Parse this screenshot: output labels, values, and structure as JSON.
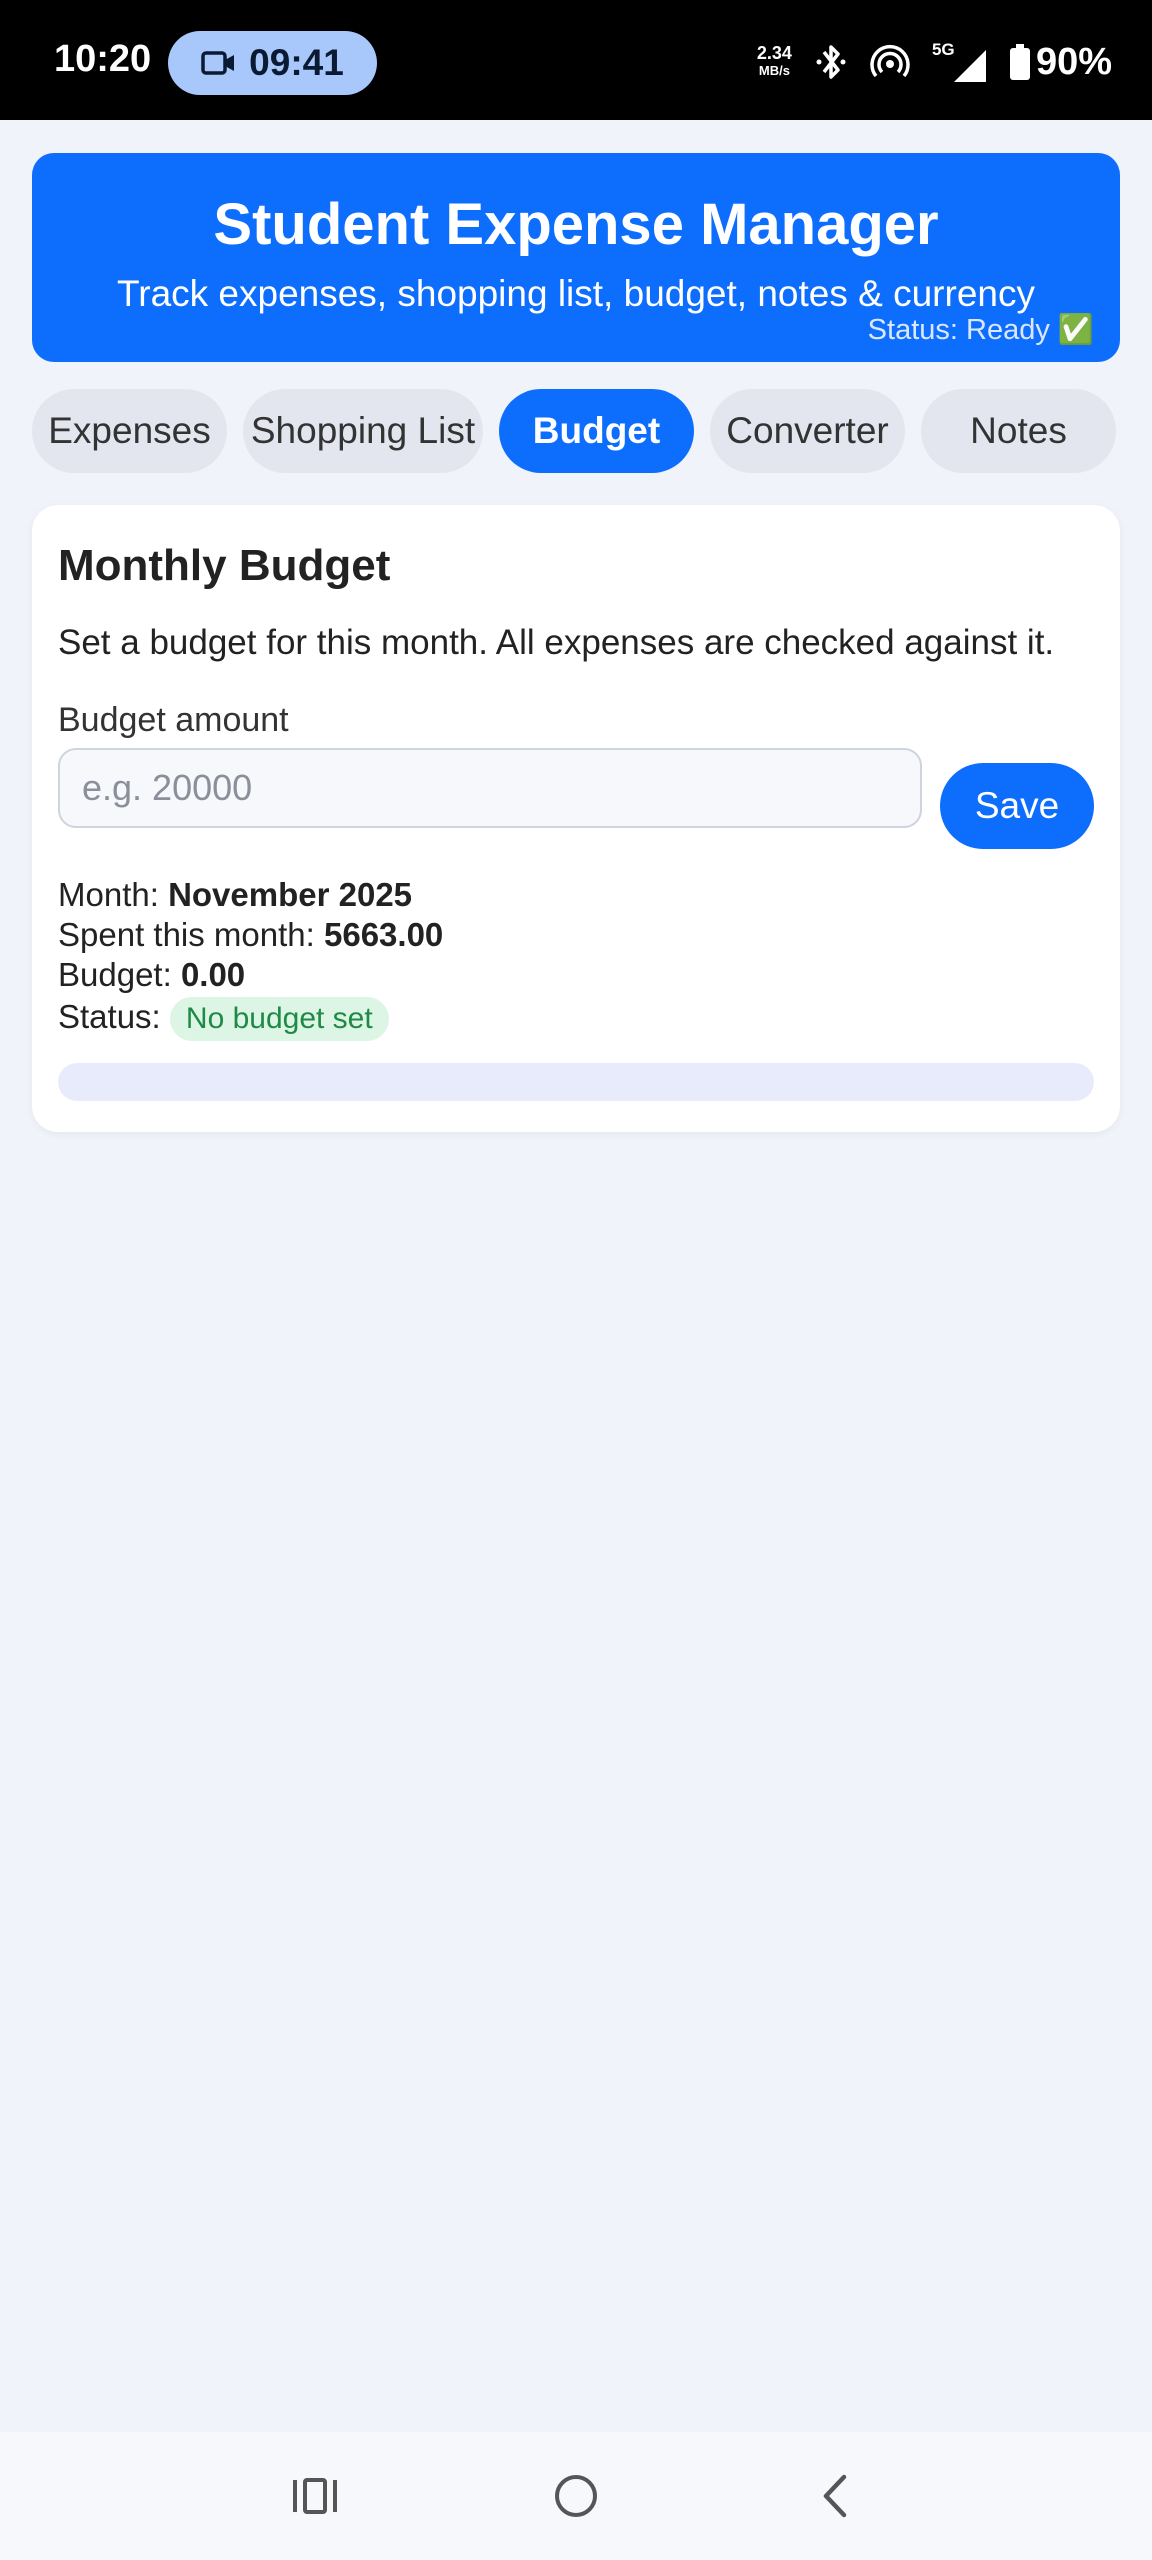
{
  "statusbar": {
    "time": "10:20",
    "recording_time": "09:41",
    "net_speed_value": "2.34",
    "net_speed_unit": "MB/s",
    "network": "5G",
    "battery": "90%"
  },
  "header": {
    "title": "Student Expense Manager",
    "subtitle": "Track expenses, shopping list, budget, notes & currency",
    "status": "Status: Ready ✅"
  },
  "tabs": [
    {
      "label": "Expenses",
      "active": false
    },
    {
      "label": "Shopping List",
      "active": false
    },
    {
      "label": "Budget",
      "active": true
    },
    {
      "label": "Converter",
      "active": false
    },
    {
      "label": "Notes",
      "active": false
    }
  ],
  "budget": {
    "title": "Monthly Budget",
    "description": "Set a budget for this month. All expenses are checked against it.",
    "amount_label": "Budget amount",
    "amount_value": "",
    "amount_placeholder": "e.g. 20000",
    "save_label": "Save",
    "month_label": "Month:",
    "month_value": "November 2025",
    "spent_label": "Spent this month:",
    "spent_value": "5663.00",
    "budget_label": "Budget:",
    "budget_value": "0.00",
    "status_label": "Status:",
    "status_value": "No budget set",
    "progress_fraction": 0
  },
  "colors": {
    "primary": "#0d6efd",
    "background": "#f0f3fa",
    "status_badge_bg": "#dcf5e5",
    "status_badge_text": "#1f8a45"
  }
}
